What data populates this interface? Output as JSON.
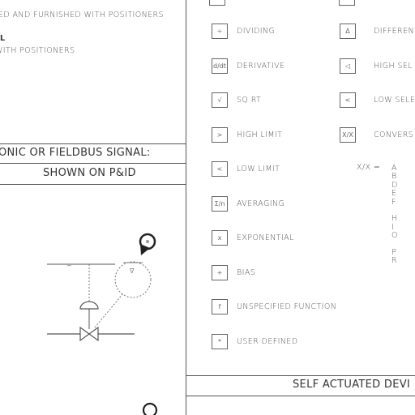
{
  "left_panel": {
    "note_line1": "ED AND FURNISHED WITH POSITIONERS",
    "note_line2_mark": "L",
    "note_line3": "WITH POSITIONERS",
    "signal_header": "ONIC OR FIELDBUS SIGNAL:",
    "shown_header": "SHOWN ON P&ID"
  },
  "right_panel": {
    "function_blocks": [
      {
        "symbol": "÷",
        "label": "DIVIDING"
      },
      {
        "symbol": "d/dt",
        "label": "DERIVATIVE"
      },
      {
        "symbol": "√",
        "label": "SQ RT"
      },
      {
        "symbol": ">",
        "label": "HIGH LIMIT"
      },
      {
        "symbol": "<",
        "label": "LOW LIMIT"
      },
      {
        "symbol": "Σ/n",
        "label": "AVERAGING"
      },
      {
        "symbol": "x",
        "label": "EXPONENTIAL"
      },
      {
        "symbol": "+",
        "label": "BIAS"
      },
      {
        "symbol": "f",
        "label": "UNSPECIFIED FUNCTION"
      },
      {
        "symbol": "*",
        "label": "USER DEFINED"
      }
    ],
    "function_blocks_col2": [
      {
        "symbol": "Δ",
        "label": "DIFFEREN"
      },
      {
        "symbol": "◁",
        "label": "HIGH SEL"
      },
      {
        "symbol": "<",
        "label": "LOW SELE"
      },
      {
        "symbol": "X/X",
        "label": "CONVERS"
      }
    ],
    "conversion_key": "X/X =",
    "conversion_letters": [
      "A",
      "B",
      "D",
      "E",
      "F",
      "",
      "H",
      "I",
      "O",
      "",
      "P",
      "R"
    ],
    "self_actuated_header": "SELF ACTUATED DEVI"
  },
  "colors": {
    "line": "#555555",
    "text": "#333333"
  }
}
